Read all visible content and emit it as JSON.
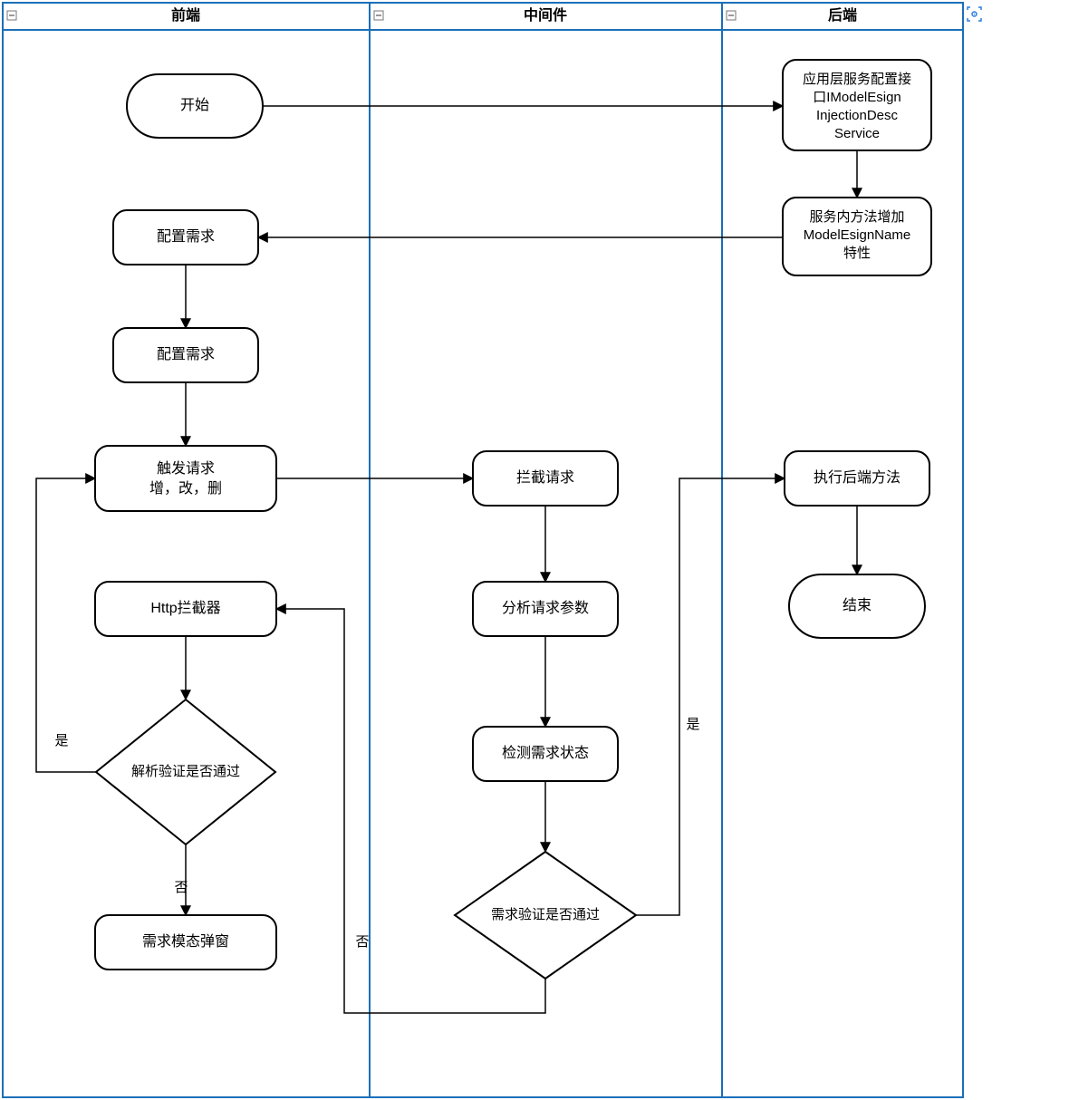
{
  "lanes": {
    "frontend": "前端",
    "middleware": "中间件",
    "backend": "后端"
  },
  "nodes": {
    "start": "开始",
    "config1": "配置需求",
    "config2": "配置需求",
    "trigger_l1": "触发请求",
    "trigger_l2": "增，改，删",
    "http_interceptor": "Http拦截器",
    "decision_fe": "解析验证是否通过",
    "modal": "需求模态弹窗",
    "intercept": "拦截请求",
    "analyze": "分析请求参数",
    "check_state": "检测需求状态",
    "decision_mw": "需求验证是否通过",
    "svc_l1": "应用层服务配置接",
    "svc_l2": "口IModelEsign",
    "svc_l3": "InjectionDesc",
    "svc_l4": "Service",
    "attr_l1": "服务内方法增加",
    "attr_l2": "ModelEsignName",
    "attr_l3": "特性",
    "exec": "执行后端方法",
    "end": "结束"
  },
  "edge_labels": {
    "yes": "是",
    "no": "否"
  }
}
